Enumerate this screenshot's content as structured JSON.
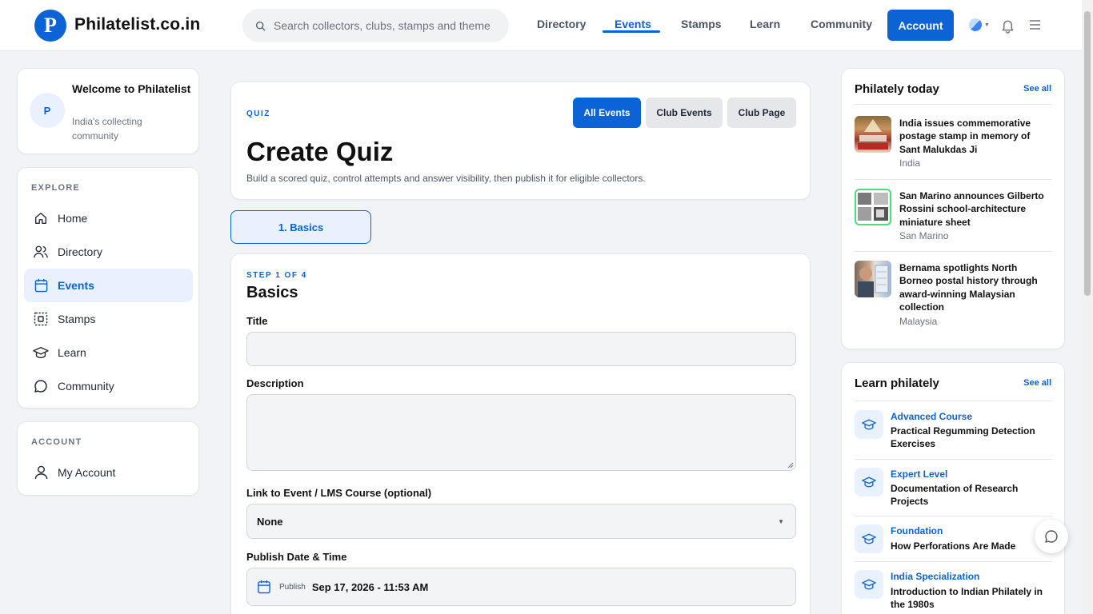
{
  "header": {
    "logo_letter": "P",
    "site_name": "Philatelist.co.in",
    "search_placeholder": "Search collectors, clubs, stamps and themes",
    "nav": [
      "Directory",
      "Events",
      "Stamps",
      "Learn",
      "Community"
    ],
    "active_nav": "Events",
    "account_label": "Account"
  },
  "sidebar": {
    "welcome_avatar": "P",
    "welcome_title": "Welcome to Philatelist",
    "welcome_sub": "India's collecting community",
    "explore_label": "EXPLORE",
    "explore_items": [
      "Home",
      "Directory",
      "Events",
      "Stamps",
      "Learn",
      "Community"
    ],
    "active_item": "Events",
    "account_label": "ACCOUNT",
    "account_items": [
      "My Account"
    ]
  },
  "main": {
    "kicker": "QUIZ",
    "title": "Create Quiz",
    "description": "Build a scored quiz, control attempts and answer visibility, then publish it for eligible collectors.",
    "buttons": [
      "All Events",
      "Club Events",
      "Club Page"
    ],
    "step_tab": "1. Basics",
    "step_label": "STEP 1 OF 4",
    "form_title": "Basics",
    "title_label": "Title",
    "title_value": "",
    "description_label": "Description",
    "description_value": "",
    "link_label": "Link to Event / LMS Course (optional)",
    "link_value": "None",
    "publish_label": "Publish Date & Time",
    "publish_sub": "Publish",
    "publish_value": "Sep 17, 2026 - 11:53 AM"
  },
  "right": {
    "today_title": "Philately today",
    "today_see_all": "See all",
    "news": [
      {
        "title": "India issues commemorative postage stamp in memory of Sant Malukdas Ji",
        "country": "India"
      },
      {
        "title": "San Marino announces Gilberto Rossini school-architecture miniature sheet",
        "country": "San Marino"
      },
      {
        "title": "Bernama spotlights North Borneo postal history through award-winning Malaysian collection",
        "country": "Malaysia"
      }
    ],
    "learn_title": "Learn philately",
    "learn_see_all": "See all",
    "courses": [
      {
        "level": "Advanced Course",
        "title": "Practical Regumming Detection Exercises"
      },
      {
        "level": "Expert Level",
        "title": "Documentation of Research Projects"
      },
      {
        "level": "Foundation",
        "title": "How Perforations Are Made"
      },
      {
        "level": "India Specialization",
        "title": "Introduction to Indian Philately in the 1980s"
      }
    ]
  },
  "colors": {
    "brand": "#0b63d6",
    "active_bg": "#e8f1fd",
    "page_bg": "#f1f3f6"
  },
  "icons": [
    "search-icon",
    "theme-icon",
    "bell-icon",
    "menu-icon",
    "home-icon",
    "users-icon",
    "calendar-icon",
    "stamp-icon",
    "graduation-cap-icon",
    "chat-icon",
    "user-icon"
  ]
}
